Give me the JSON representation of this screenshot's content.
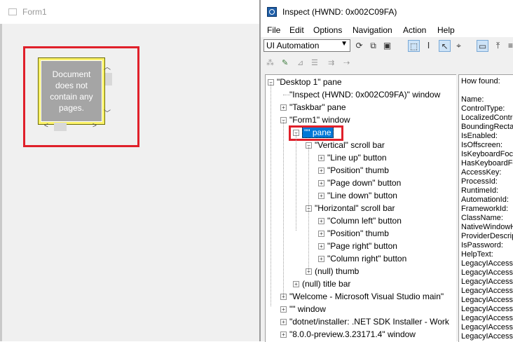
{
  "form1": {
    "title": "Form1",
    "document_text": "Document does not contain any pages."
  },
  "inspect": {
    "title": "Inspect  (HWND: 0x002C09FA)",
    "menu": [
      "File",
      "Edit",
      "Options",
      "Navigation",
      "Action",
      "Help"
    ],
    "mode_combo": "UI Automation",
    "tree": [
      {
        "label": "\"Desktop 1\" pane",
        "level": 0,
        "exp": "-"
      },
      {
        "label": "\"Inspect  (HWND: 0x002C09FA)\" window",
        "level": 1,
        "exp": ""
      },
      {
        "label": "\"Taskbar\" pane",
        "level": 1,
        "exp": "+"
      },
      {
        "label": "\"Form1\" window",
        "level": 1,
        "exp": "-"
      },
      {
        "label": "\"\" pane",
        "level": 2,
        "exp": "-",
        "selected": true
      },
      {
        "label": "\"Vertical\" scroll bar",
        "level": 3,
        "exp": "-"
      },
      {
        "label": "\"Line up\" button",
        "level": 4,
        "exp": "+"
      },
      {
        "label": "\"Position\" thumb",
        "level": 4,
        "exp": "+"
      },
      {
        "label": "\"Page down\" button",
        "level": 4,
        "exp": "+"
      },
      {
        "label": "\"Line down\" button",
        "level": 4,
        "exp": "+"
      },
      {
        "label": "\"Horizontal\" scroll bar",
        "level": 3,
        "exp": "-"
      },
      {
        "label": "\"Column left\" button",
        "level": 4,
        "exp": "+"
      },
      {
        "label": "\"Position\" thumb",
        "level": 4,
        "exp": "+"
      },
      {
        "label": "\"Page right\" button",
        "level": 4,
        "exp": "+"
      },
      {
        "label": "\"Column right\" button",
        "level": 4,
        "exp": "+"
      },
      {
        "label": "(null) thumb",
        "level": 3,
        "exp": "+"
      },
      {
        "label": "(null) title bar",
        "level": 2,
        "exp": "+"
      },
      {
        "label": "\"Welcome - Microsoft Visual Studio main\"",
        "level": 1,
        "exp": "+"
      },
      {
        "label": "\"\" window",
        "level": 1,
        "exp": "+"
      },
      {
        "label": "\"dotnet/installer: .NET SDK Installer - Work",
        "level": 1,
        "exp": "+"
      },
      {
        "label": "\"8.0.0-preview.3.23171.4\" window",
        "level": 1,
        "exp": "+"
      }
    ],
    "properties": [
      "How found:",
      "",
      "Name:",
      "ControlType:",
      "LocalizedControlType:",
      "BoundingRectangle:",
      "IsEnabled:",
      "IsOffscreen:",
      "IsKeyboardFocusable:",
      "HasKeyboardFocus:",
      "AccessKey:",
      "ProcessId:",
      "RuntimeId:",
      "AutomationId:",
      "FrameworkId:",
      "ClassName:",
      "NativeWindowHandle:",
      "ProviderDescription:",
      "IsPassword:",
      "HelpText:",
      "LegacyIAccessible.ChildId:",
      "LegacyIAccessible.DefaultAction:",
      "LegacyIAccessible.Description:",
      "LegacyIAccessible.Help:",
      "LegacyIAccessible.KeyboardShortcut:",
      "LegacyIAccessible.Name:",
      "LegacyIAccessible.Role:",
      "LegacyIAccessible.State:",
      "LegacyIAccessible.Value:"
    ]
  },
  "colors": {
    "highlight_red": "#e0202a",
    "selection_blue": "#0078d7",
    "doc_yellow": "#fcf26a"
  }
}
